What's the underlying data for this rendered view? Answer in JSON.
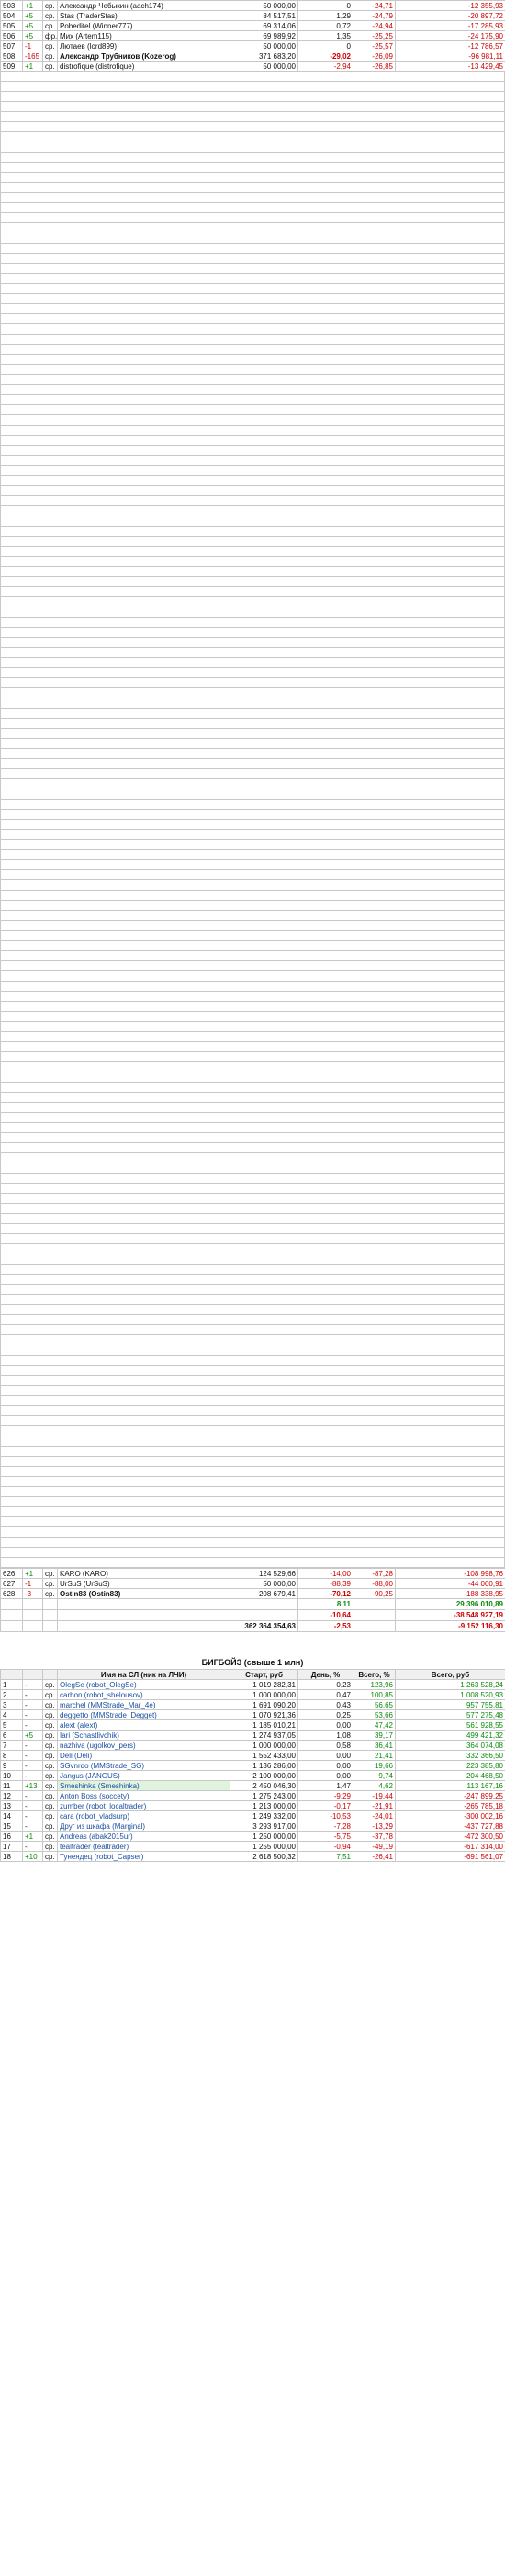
{
  "main_table": {
    "top_rows": [
      {
        "rank": "503",
        "chg": "+1",
        "div": "cp.",
        "name": "Александр Чебыкин (aach174)",
        "start": "50 000,00",
        "d1": "0",
        "d2": "-24,71",
        "sum": "-12 355,93",
        "d2s": "neg",
        "sums": "neg"
      },
      {
        "rank": "504",
        "chg": "+5",
        "div": "cp.",
        "name": "Stas (TraderStas)",
        "start": "84 517,51",
        "d1": "1,29",
        "d2": "-24,79",
        "sum": "-20 897,72",
        "d2s": "neg",
        "sums": "neg"
      },
      {
        "rank": "505",
        "chg": "+5",
        "div": "cp.",
        "name": "Pobeditel (Winner777)",
        "start": "69 314,06",
        "d1": "0,72",
        "d2": "-24,94",
        "sum": "-17 285,93",
        "d2s": "neg",
        "sums": "neg"
      },
      {
        "rank": "506",
        "chg": "+5",
        "div": "фр.",
        "name": "Мих (Artem115)",
        "start": "69 989,92",
        "d1": "1,35",
        "d2": "-25,25",
        "sum": "-24 175,90",
        "d2s": "neg",
        "sums": "neg"
      },
      {
        "rank": "507",
        "chg": "-1",
        "div": "cp.",
        "name": "Лютаев (lord899)",
        "start": "50 000,00",
        "d1": "0",
        "d2": "-25,57",
        "sum": "-12 786,57",
        "d2s": "neg",
        "sums": "neg"
      },
      {
        "rank": "508",
        "chg": "-165",
        "div": "cp.",
        "name": "Александр Трубников (Kozerog)",
        "start": "371 683,20",
        "d1": "-29,02",
        "d2": "-26,09",
        "sum": "-96 981,11",
        "d1s": "neg",
        "d2s": "neg",
        "sums": "neg",
        "bold": true
      },
      {
        "rank": "509",
        "chg": "+1",
        "div": "cp.",
        "name": "distrofique (distrofique)",
        "start": "50 000,00",
        "d1": "-2,94",
        "d2": "-26,85",
        "sum": "-13 429,45",
        "d1s": "neg",
        "d2s": "neg",
        "sums": "neg"
      }
    ],
    "mid_rows_note": "",
    "bottom_rows": [
      {
        "rank": "626",
        "chg": "+1",
        "div": "cp.",
        "name": "KARO (KARO)",
        "start": "124 529,66",
        "d1": "-14,00",
        "d2": "-87,28",
        "sum": "-108 998,76",
        "d1s": "neg",
        "d2s": "neg",
        "sums": "neg"
      },
      {
        "rank": "627",
        "chg": "-1",
        "div": "cp.",
        "name": "UrSuS (UrSuS)",
        "start": "50 000,00",
        "d1": "-88,39",
        "d2": "-88,00",
        "sum": "-44 000,91",
        "d1s": "neg",
        "d2s": "neg",
        "sums": "neg"
      },
      {
        "rank": "628",
        "chg": "-3",
        "div": "cp.",
        "name": "Ostin83 (Ostin83)",
        "start": "208 679,41",
        "d1": "-70,12",
        "d2": "-90,25",
        "sum": "-188 338,95",
        "d1s": "neg",
        "d2s": "neg",
        "sums": "neg",
        "bold": true
      }
    ],
    "totals": {
      "sum_row": "362 364 354,63",
      "d1_a": "8,11",
      "d2_a": "29 396 010,89",
      "d1_b": "-10,64",
      "d2_b": "-38 548 927,19",
      "d1_c": "-2,53",
      "d2_c": "-9 152 116,30"
    }
  },
  "bigboy": {
    "title": "БИГБОЙЗ (свыше 1 млн)",
    "headers": [
      "",
      "",
      "",
      "Имя на СЛ (ник на ЛЧИ)",
      "Старт, руб",
      "День, %",
      "Всего, %",
      "Всего, руб"
    ],
    "rows": [
      {
        "rank": "1",
        "chg": "-",
        "div": "cp.",
        "name": "OlegSe (robot_OlegSe)",
        "start": "1 019 282,31",
        "d1": "0,23",
        "d2": "123,96",
        "sum": "1 263 528,24",
        "d2s": "pos",
        "sums": "pos"
      },
      {
        "rank": "2",
        "chg": "-",
        "div": "cp.",
        "name": "carbon (robot_shelousov)",
        "start": "1 000 000,00",
        "d1": "0,47",
        "d2": "100,85",
        "sum": "1 008 520,93",
        "d2s": "pos",
        "sums": "pos"
      },
      {
        "rank": "3",
        "chg": "-",
        "div": "cp.",
        "name": "marchel (MMStrade_Mar_4e)",
        "start": "1 691 090,20",
        "d1": "0,43",
        "d2": "56,65",
        "sum": "957 755,81",
        "d2s": "pos",
        "sums": "pos"
      },
      {
        "rank": "4",
        "chg": "-",
        "div": "cp.",
        "name": "deggetto (MMStrade_Degget)",
        "start": "1 070 921,36",
        "d1": "0,25",
        "d2": "53,66",
        "sum": "577 275,48",
        "d2s": "pos",
        "sums": "pos"
      },
      {
        "rank": "5",
        "chg": "-",
        "div": "cp.",
        "name": "alext (alext)",
        "start": "1 185 010,21",
        "d1": "0,00",
        "d2": "47,42",
        "sum": "561 928,55",
        "d2s": "pos",
        "sums": "pos"
      },
      {
        "rank": "6",
        "chg": "+5",
        "div": "cp.",
        "name": "Iari (Schastlivchik)",
        "start": "1 274 937,05",
        "d1": "1,08",
        "d2": "39,17",
        "sum": "499 421,32",
        "d2s": "pos",
        "sums": "pos"
      },
      {
        "rank": "7",
        "chg": "-",
        "div": "cp.",
        "name": "nazhiva (ugolkov_pers)",
        "start": "1 000 000,00",
        "d1": "0,58",
        "d2": "36,41",
        "sum": "364 074,08",
        "d2s": "pos",
        "sums": "pos"
      },
      {
        "rank": "8",
        "chg": "-",
        "div": "cp.",
        "name": "Deli (Deli)",
        "start": "1 552 433,00",
        "d1": "0,00",
        "d2": "21,41",
        "sum": "332 366,50",
        "d2s": "pos",
        "sums": "pos"
      },
      {
        "rank": "9",
        "chg": "-",
        "div": "cp.",
        "name": "SGvnrdo (MMStrade_SG)",
        "start": "1 136 286,00",
        "d1": "0,00",
        "d2": "19,66",
        "sum": "223 385,80",
        "d2s": "pos",
        "sums": "pos"
      },
      {
        "rank": "10",
        "chg": "-",
        "div": "cp.",
        "name": "Jangus (JANGUS)",
        "start": "2 100 000,00",
        "d1": "0,00",
        "d2": "9,74",
        "sum": "204 468,50",
        "d2s": "pos",
        "sums": "pos"
      },
      {
        "rank": "11",
        "chg": "+13",
        "div": "cp.",
        "name": "Smeshinka (Smeshinka)",
        "start": "2 450 046,30",
        "d1": "1,47",
        "d2": "4,62",
        "sum": "113 167,16",
        "d2s": "pos",
        "sums": "pos",
        "highlight": true
      },
      {
        "rank": "12",
        "chg": "-",
        "div": "cp.",
        "name": "Anton Boss (soccety)",
        "start": "1 275 243,00",
        "d1": "-9,29",
        "d2": "-19,44",
        "sum": "-247 899,25",
        "d1s": "neg",
        "d2s": "neg",
        "sums": "neg"
      },
      {
        "rank": "13",
        "chg": "-",
        "div": "cp.",
        "name": "zumber (robot_localtrader)",
        "start": "1 213 000,00",
        "d1": "-0,17",
        "d2": "-21,91",
        "sum": "-265 785,18",
        "d1s": "neg",
        "d2s": "neg",
        "sums": "neg"
      },
      {
        "rank": "14",
        "chg": "-",
        "div": "cp.",
        "name": "cara (robot_vladsurp)",
        "start": "1 249 332,00",
        "d1": "-10,53",
        "d2": "-24,01",
        "sum": "-300 002,16",
        "d1s": "neg",
        "d2s": "neg",
        "sums": "neg"
      },
      {
        "rank": "15",
        "chg": "-",
        "div": "cp.",
        "name": "Друг из шкафа (Marginal)",
        "start": "3 293 917,00",
        "d1": "-7,28",
        "d2": "-13,29",
        "sum": "-437 727,88",
        "d1s": "neg",
        "d2s": "neg",
        "sums": "neg"
      },
      {
        "rank": "16",
        "chg": "+1",
        "div": "cp.",
        "name": "Andreas (abak2015ur)",
        "start": "1 250 000,00",
        "d1": "-5,75",
        "d2": "-37,78",
        "sum": "-472 300,50",
        "d1s": "neg",
        "d2s": "neg",
        "sums": "neg"
      },
      {
        "rank": "17",
        "chg": "-",
        "div": "cp.",
        "name": "tealtrader (tealtrader)",
        "start": "1 255 000,00",
        "d1": "-0,94",
        "d2": "-49,19",
        "sum": "-617 314,00",
        "d1s": "neg",
        "d2s": "neg",
        "sums": "neg"
      },
      {
        "rank": "18",
        "chg": "+10",
        "div": "cp.",
        "name": "Тунеядец (robot_Capser)",
        "start": "2 618 500,32",
        "d1": "7,51",
        "d2": "-26,41",
        "sum": "-691 561,07",
        "d1s": "pos",
        "d2s": "neg",
        "sums": "neg"
      }
    ]
  }
}
